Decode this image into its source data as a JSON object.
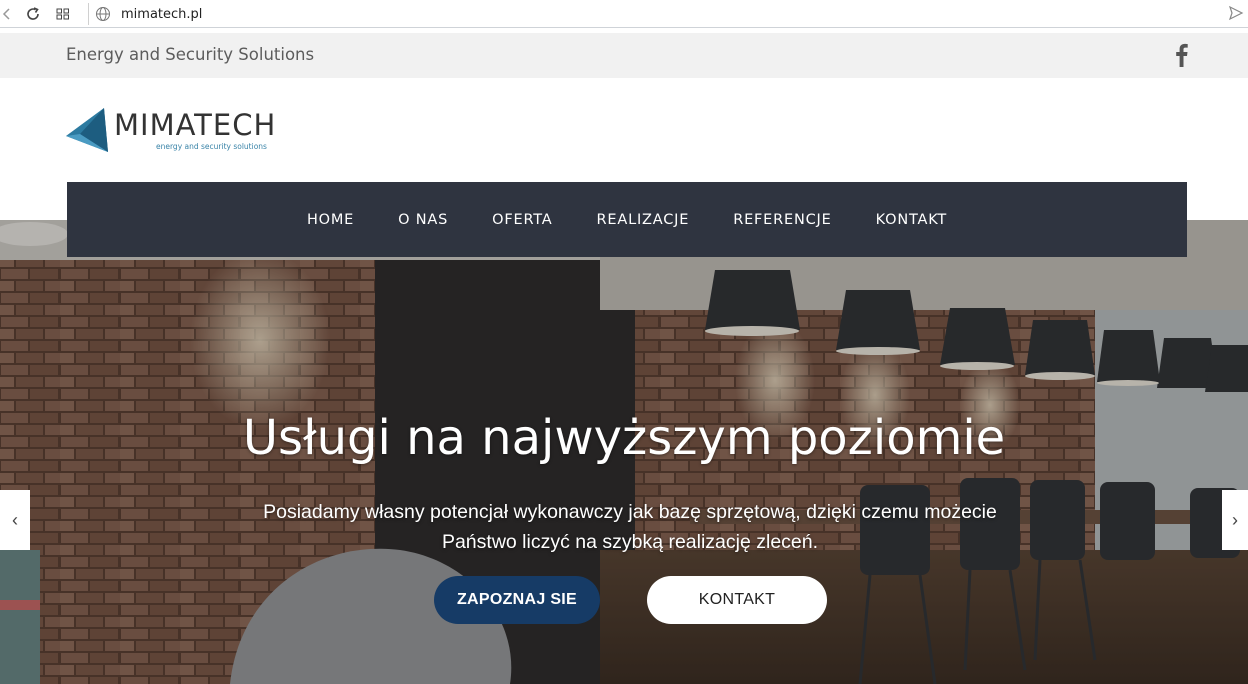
{
  "browser": {
    "url": "mimatech.pl"
  },
  "topbar": {
    "tagline": "Energy and Security Solutions",
    "social_icon": "facebook-icon"
  },
  "logo": {
    "name": "MIMATECH",
    "subtitle": "energy and security solutions",
    "color": "#2c7aa0"
  },
  "nav": {
    "items": [
      {
        "label": "HOME"
      },
      {
        "label": "O NAS"
      },
      {
        "label": "OFERTA"
      },
      {
        "label": "REALIZACJE"
      },
      {
        "label": "REFERENCJE"
      },
      {
        "label": "KONTAKT"
      }
    ]
  },
  "hero": {
    "title": "Usługi na najwyższym poziomie",
    "text": "Posiadamy własny potencjał wykonawczy jak bazę sprzętową, dzięki czemu możecie Państwo liczyć na szybką realizację zleceń.",
    "primary_button": "ZAPOZNAJ SIE",
    "secondary_button": "KONTAKT",
    "prev_arrow": "‹",
    "next_arrow": "›"
  },
  "colors": {
    "nav_bg": "#2f3440",
    "primary_button": "#163b66",
    "topbar_bg": "#f1f1f1"
  }
}
